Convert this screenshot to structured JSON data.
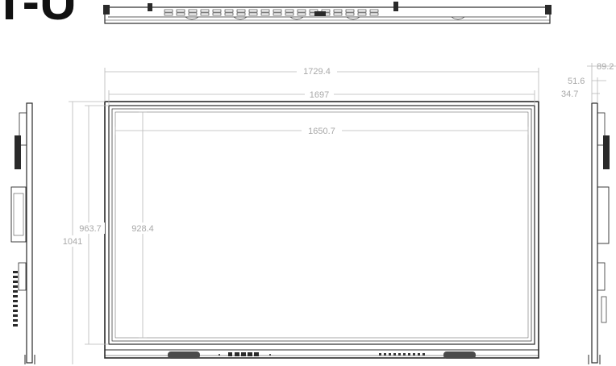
{
  "drawing": {
    "corner_label": "T-U",
    "dimensions": {
      "overall_width": "1729.4",
      "bezel_width": "1697",
      "active_width": "1650.7",
      "bezel_height": "963.7",
      "active_height": "928.4",
      "overall_height": "1041",
      "depth_total": "89.2",
      "depth_mid": "51.6",
      "depth_panel": "34.7"
    }
  }
}
